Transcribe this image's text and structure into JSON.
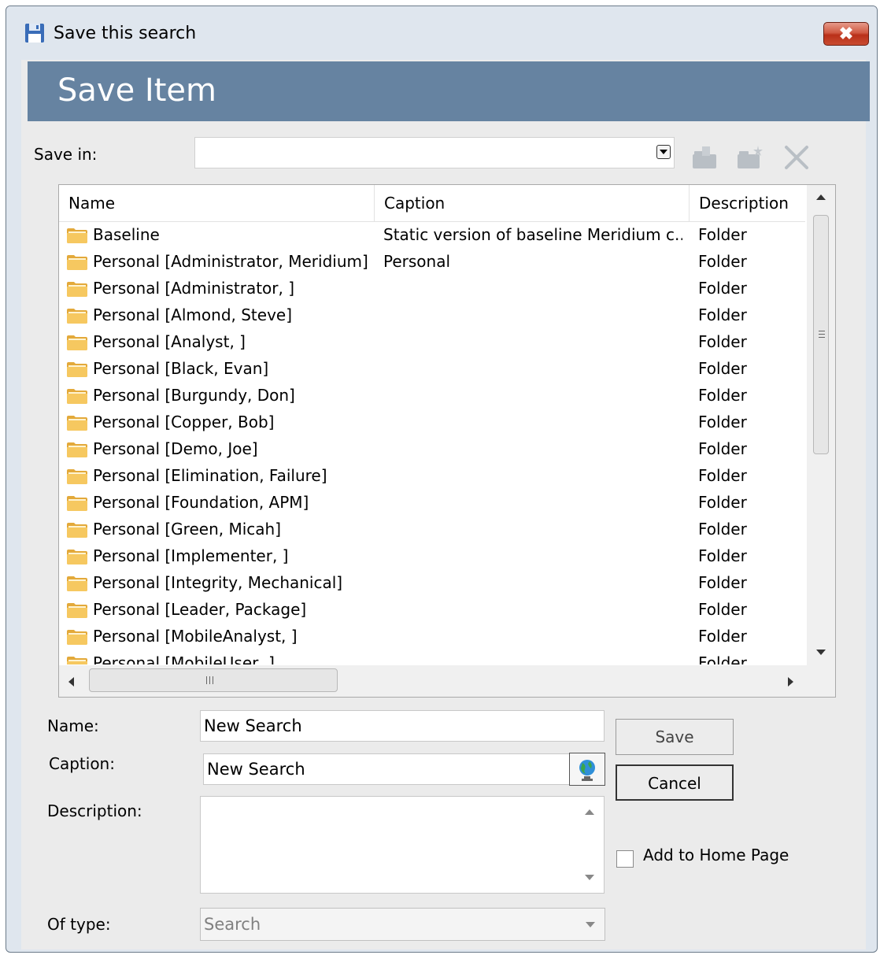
{
  "window": {
    "title": "Save this search",
    "close_label": "✖"
  },
  "header": {
    "title": "Save Item"
  },
  "save_in": {
    "label": "Save in:",
    "value": ""
  },
  "columns": [
    "Name",
    "Caption",
    "Description"
  ],
  "rows": [
    {
      "name": "Baseline",
      "caption": "Static version of baseline Meridium c...",
      "description": "Folder"
    },
    {
      "name": "Personal [Administrator, Meridium]",
      "caption": "Personal",
      "description": "Folder"
    },
    {
      "name": "Personal [Administrator, ]",
      "caption": "",
      "description": "Folder"
    },
    {
      "name": "Personal [Almond, Steve]",
      "caption": "",
      "description": "Folder"
    },
    {
      "name": "Personal [Analyst, ]",
      "caption": "",
      "description": "Folder"
    },
    {
      "name": "Personal [Black, Evan]",
      "caption": "",
      "description": "Folder"
    },
    {
      "name": "Personal [Burgundy, Don]",
      "caption": "",
      "description": "Folder"
    },
    {
      "name": "Personal [Copper, Bob]",
      "caption": "",
      "description": "Folder"
    },
    {
      "name": "Personal [Demo, Joe]",
      "caption": "",
      "description": "Folder"
    },
    {
      "name": "Personal [Elimination, Failure]",
      "caption": "",
      "description": "Folder"
    },
    {
      "name": "Personal [Foundation, APM]",
      "caption": "",
      "description": "Folder"
    },
    {
      "name": "Personal [Green, Micah]",
      "caption": "",
      "description": "Folder"
    },
    {
      "name": "Personal [Implementer, ]",
      "caption": "",
      "description": "Folder"
    },
    {
      "name": "Personal [Integrity, Mechanical]",
      "caption": "",
      "description": "Folder"
    },
    {
      "name": "Personal [Leader, Package]",
      "caption": "",
      "description": "Folder"
    },
    {
      "name": "Personal [MobileAnalyst, ]",
      "caption": "",
      "description": "Folder"
    },
    {
      "name": "Personal [MobileUser, ]",
      "caption": "",
      "description": "Folder"
    }
  ],
  "form": {
    "name_label": "Name:",
    "name_value": "New Search",
    "caption_label": "Caption:",
    "caption_value": "New Search",
    "description_label": "Description:",
    "description_value": "",
    "type_label": "Of type:",
    "type_value": "Search"
  },
  "buttons": {
    "save": "Save",
    "cancel": "Cancel"
  },
  "add_home": {
    "label": "Add to Home Page",
    "checked": false
  },
  "icons": {
    "title": "floppy-disk-icon",
    "folder": "folder-icon",
    "globe": "globe-icon",
    "toolbar": [
      "folder-up-icon",
      "new-folder-icon",
      "delete-icon"
    ]
  },
  "colors": {
    "header_band": "#6683a1",
    "close_button": "#c94c31",
    "folder": "#f6c860"
  }
}
